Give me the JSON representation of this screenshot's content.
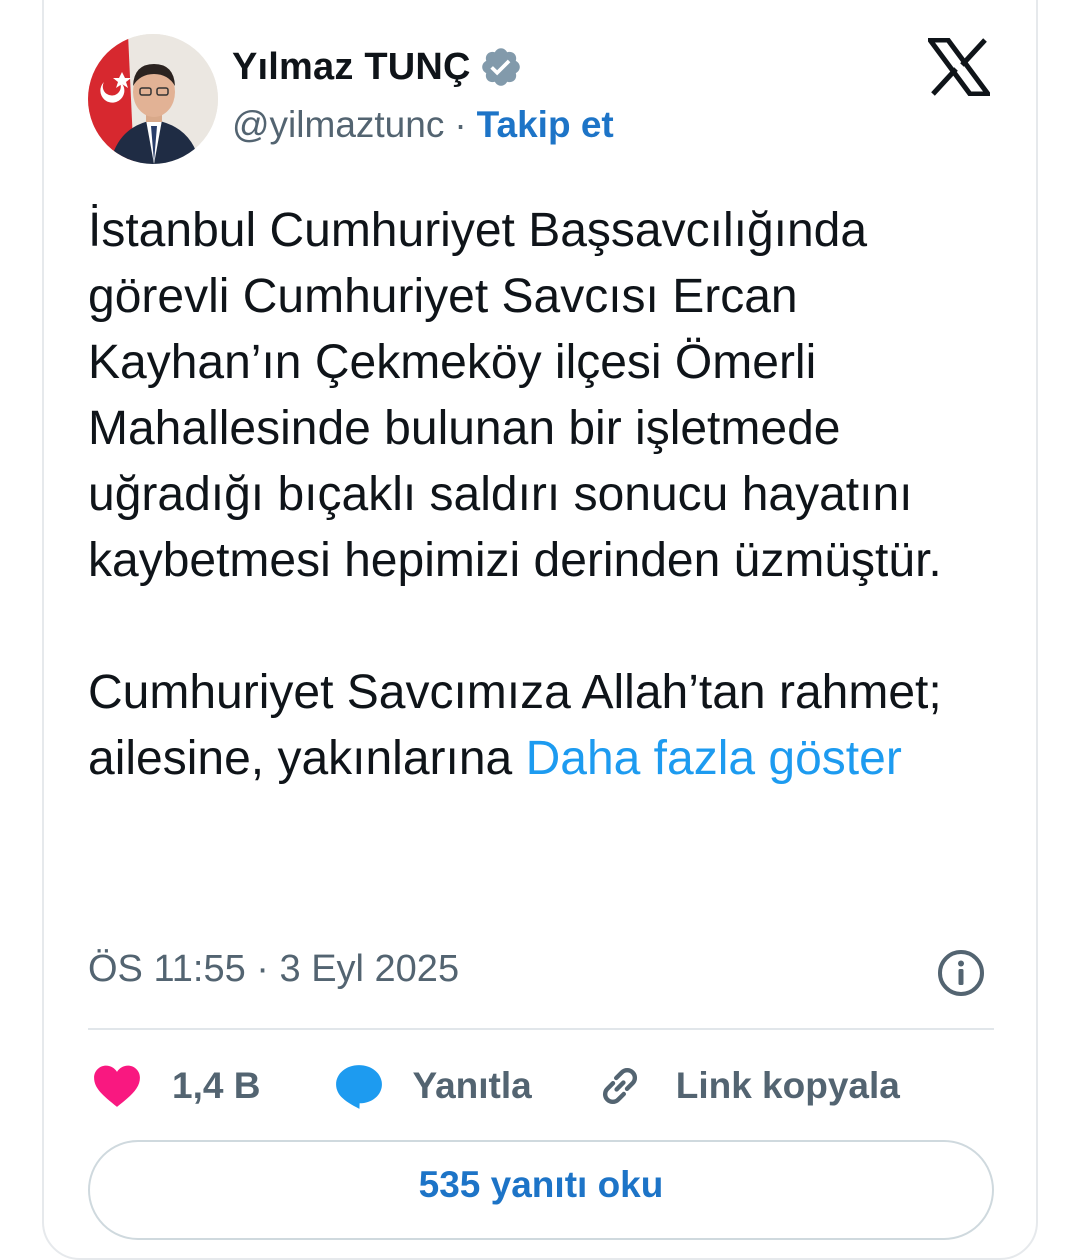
{
  "author": {
    "name": "Yılmaz TUNÇ",
    "handle": "@yilmaztunc",
    "separator": "·",
    "follow_label": "Takip et",
    "verified_icon": "verified-badge-icon"
  },
  "platform_icon": "x-logo-icon",
  "tweet": {
    "paragraph1": "İstanbul Cumhuriyet Başsavcılığında görevli Cumhuriyet Savcısı Ercan Kayhan’ın Çekmeköy ilçesi Ömerli Mahallesinde bulunan bir işletmede uğradığı bıçaklı saldırı sonucu hayatını kaybetmesi hepimizi derinden üzmüştür.",
    "paragraph2": "Cumhuriyet Savcımıza Allah’tan rahmet; ailesine, yakınlarına",
    "show_more_label": "Daha fazla göster",
    "timestamp": "ÖS 11:55 · 3 Eyl 2025"
  },
  "actions": {
    "like_count": "1,4 B",
    "reply_label": "Yanıtla",
    "copy_link_label": "Link kopyala"
  },
  "read_replies_label": "535 yanıtı oku",
  "colors": {
    "accent": "#1d9bf0",
    "verified": "#829aab",
    "like": "#f91880",
    "reply": "#1d9bf0",
    "muted": "#536471"
  }
}
